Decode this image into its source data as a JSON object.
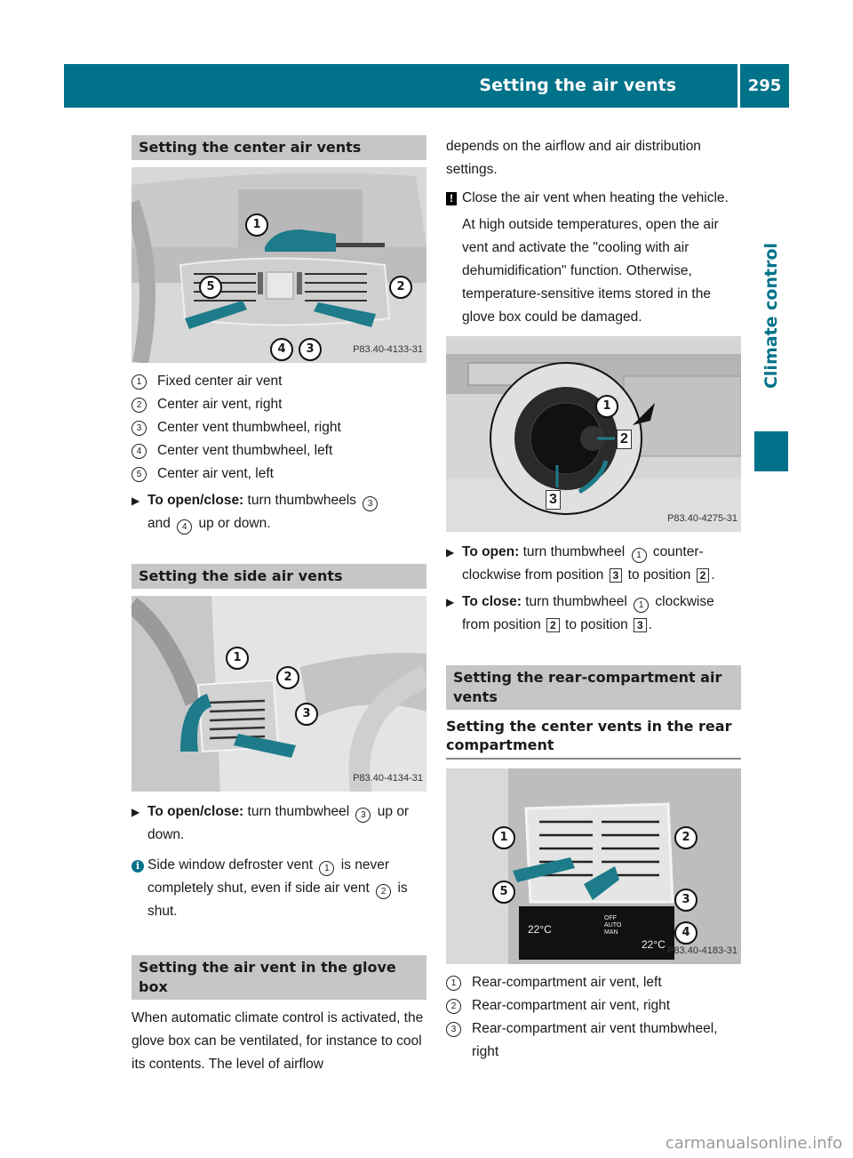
{
  "header": {
    "title": "Setting the air vents",
    "page_number": "295"
  },
  "side_tab": {
    "label": "Climate control"
  },
  "left": {
    "center_vents": {
      "heading": "Setting the center air vents",
      "figure_code": "P83.40-4133-31",
      "callouts": [
        "1",
        "2",
        "3",
        "4",
        "5"
      ],
      "legend": [
        {
          "num": "1",
          "text": "Fixed center air vent"
        },
        {
          "num": "2",
          "text": "Center air vent, right"
        },
        {
          "num": "3",
          "text": "Center vent thumbwheel, right"
        },
        {
          "num": "4",
          "text": "Center vent thumbwheel, left"
        },
        {
          "num": "5",
          "text": "Center air vent, left"
        }
      ],
      "step": {
        "label": "To open/close:",
        "text_a": "turn thumbwheels",
        "ref_a": "3",
        "text_b": "and",
        "ref_b": "4",
        "text_c": "up or down."
      }
    },
    "side_vents": {
      "heading": "Setting the side air vents",
      "figure_code": "P83.40-4134-31",
      "callouts": [
        "1",
        "2",
        "3"
      ],
      "step": {
        "label": "To open/close:",
        "text_a": "turn thumbwheel",
        "ref_a": "3",
        "text_b": "up or down."
      },
      "info": {
        "text_a": "Side window defroster vent",
        "ref_a": "1",
        "text_b": "is never completely shut, even if side air vent",
        "ref_b": "2",
        "text_c": "is shut."
      }
    },
    "glove_box": {
      "heading": "Setting the air vent in the glove box",
      "body": "When automatic climate control is activated, the glove box can be ventilated, for instance to cool its contents. The level of airflow"
    }
  },
  "right": {
    "continuation": "depends on the airflow and air distribution settings.",
    "warning": {
      "line1": "Close the air vent when heating the vehicle.",
      "line2": "At high outside temperatures, open the air vent and activate the \"cooling with air dehumidification\" function. Otherwise, temperature-sensitive items stored in the glove box could be damaged."
    },
    "glove_figure": {
      "figure_code": "P83.40-4275-31",
      "callout": "1",
      "positions": [
        "2",
        "3"
      ]
    },
    "steps": [
      {
        "label": "To open:",
        "text_a": "turn thumbwheel",
        "ref": "1",
        "text_b": "counter-clockwise from position",
        "pos_a": "3",
        "text_c": "to position",
        "pos_b": "2",
        "end": "."
      },
      {
        "label": "To close:",
        "text_a": "turn thumbwheel",
        "ref": "1",
        "text_b": "clockwise from position",
        "pos_a": "2",
        "text_c": "to position",
        "pos_b": "3",
        "end": "."
      }
    ],
    "rear": {
      "heading": "Setting the rear-compartment air vents",
      "subheading": "Setting the center vents in the rear compartment",
      "figure_code": "P83.40-4183-31",
      "callouts": [
        "1",
        "2",
        "3",
        "4",
        "5"
      ],
      "display": {
        "temp_left": "22°C",
        "temp_right": "22°C",
        "modes": [
          "OFF",
          "AUTO",
          "MAN"
        ]
      },
      "legend": [
        {
          "num": "1",
          "text": "Rear-compartment air vent, left"
        },
        {
          "num": "2",
          "text": "Rear-compartment air vent, right"
        },
        {
          "num": "3",
          "text": "Rear-compartment air vent thumbwheel, right"
        }
      ]
    }
  },
  "footer": {
    "watermark": "carmanualsonline.info"
  }
}
